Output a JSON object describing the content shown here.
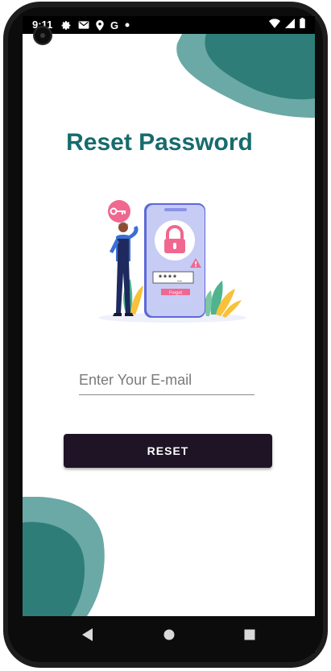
{
  "status_bar": {
    "time": "9:11",
    "icons_left": [
      "gear-icon",
      "mail-icon",
      "location-icon",
      "google-icon",
      "dot-icon"
    ],
    "google_letter": "G",
    "icons_right": [
      "wifi-icon",
      "signal-icon",
      "battery-icon"
    ]
  },
  "page": {
    "title": "Reset Password"
  },
  "illustration": {
    "password_mask": "****_",
    "forgot_label": "Forgot",
    "icons": [
      "key-icon",
      "lock-icon",
      "warning-icon"
    ]
  },
  "form": {
    "email_placeholder": "Enter Your E-mail",
    "email_value": "",
    "reset_label": "RESET"
  },
  "nav_bar": {
    "buttons": [
      "back-icon",
      "home-icon",
      "recents-icon"
    ]
  },
  "colors": {
    "title": "#176b6c",
    "blob_dark": "#2e7d78",
    "blob_light": "#6aa9a5",
    "button_bg": "#1f1326",
    "phone_screen": "#c7ccf5",
    "lock_pink": "#f0688f"
  }
}
